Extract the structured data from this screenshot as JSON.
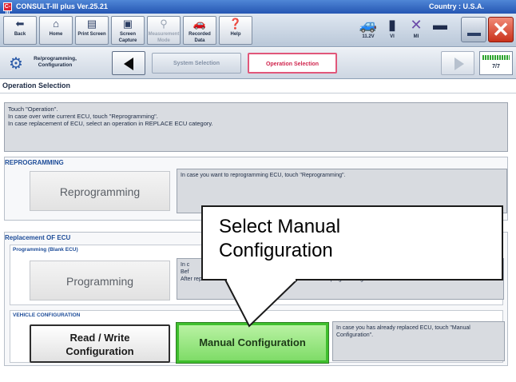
{
  "window": {
    "logo_text": "C-III",
    "title": "CONSULT-III plus  Ver.25.21",
    "country": "Country : U.S.A."
  },
  "toolbar": {
    "buttons": [
      {
        "label": "Back",
        "icon": "back-arrow-icon"
      },
      {
        "label": "Home",
        "icon": "home-icon"
      },
      {
        "label": "Print Screen",
        "icon": "printer-icon"
      },
      {
        "label": "Screen Capture",
        "icon": "camera-icon"
      },
      {
        "label": "Measurement Mode",
        "icon": "measurement-icon"
      },
      {
        "label": "Recorded Data",
        "icon": "recorded-data-icon"
      },
      {
        "label": "Help",
        "icon": "help-icon"
      }
    ],
    "status": [
      {
        "label": "11.2V",
        "icon": "car-battery-icon"
      },
      {
        "label": "VI",
        "icon": "signal-icon"
      },
      {
        "label": "MI",
        "icon": "x-mark-icon"
      }
    ]
  },
  "nav": {
    "crumb_label": "Re/programming, Configuration",
    "steps": [
      "System Selection",
      "Operation Selection"
    ],
    "active_step": "Operation Selection",
    "progress": "7/7"
  },
  "screen_title": "Operation Selection",
  "instructions": [
    "Touch  \"Operation\".",
    "In case over write current ECU, touch \"Reprogramming\".",
    "In case replacement of ECU, select an operation in REPLACE ECU category."
  ],
  "reprogramming": {
    "title": "REPROGRAMMING",
    "button": "Reprogramming",
    "desc": "In case you want to reprogramming ECU, touch \"Reprogramming\"."
  },
  "replacement": {
    "title": "Replacement OF ECU",
    "programming": {
      "title": "Programming (Blank ECU)",
      "button": "Programming",
      "desc_lines": [
        "In c",
        "Bef",
        "After replace ECU",
        "CU data and programming data."
      ]
    },
    "vehicle_config": {
      "title": "VEHICLE CONFIGURATION",
      "rw_line1": "Read / Write",
      "rw_line2": "Configuration",
      "manual_button": "Manual Configuration",
      "desc": "In case you has already replaced ECU, touch \"Manual Configuration\"."
    }
  },
  "callout": {
    "line1": "Select Manual",
    "line2": "Configuration"
  },
  "colors": {
    "accent_blue": "#1d4c98",
    "active_step": "#e1577a",
    "manual_button": "#7fdc68",
    "close_red": "#c9321b"
  }
}
